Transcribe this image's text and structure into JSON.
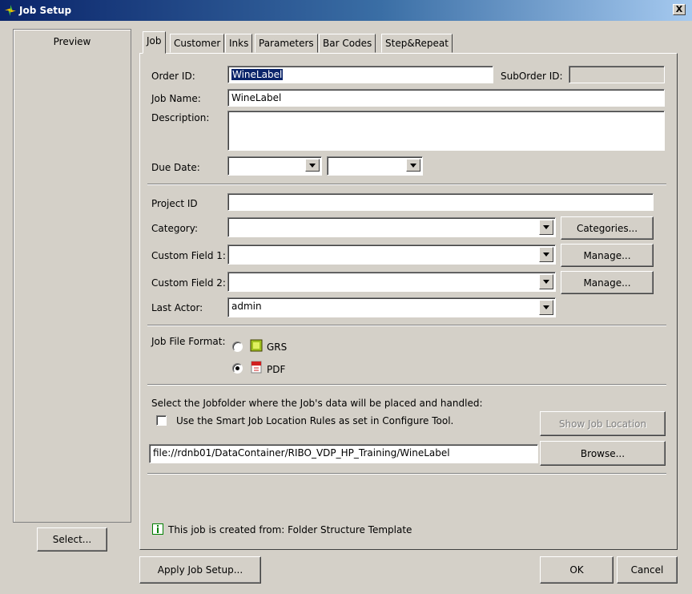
{
  "window": {
    "title": "Job Setup",
    "close_label": "X"
  },
  "preview": {
    "label": "Preview",
    "select_button": "Select..."
  },
  "tabs": [
    {
      "label": "Job"
    },
    {
      "label": "Customer"
    },
    {
      "label": "Inks"
    },
    {
      "label": "Parameters"
    },
    {
      "label": "Bar Codes"
    },
    {
      "label": "Step&Repeat"
    }
  ],
  "job": {
    "order_id_label": "Order ID:",
    "order_id_value": "WineLabel",
    "suborder_id_label": "SubOrder ID:",
    "suborder_id_value": "",
    "job_name_label": "Job Name:",
    "job_name_value": "WineLabel",
    "description_label": "Description:",
    "description_value": "",
    "due_date_label": "Due Date:",
    "due_date_value": "",
    "due_time_value": "",
    "project_id_label": "Project ID",
    "project_id_value": "",
    "category_label": "Category:",
    "category_value": "",
    "categories_button": "Categories...",
    "custom1_label": "Custom Field 1:",
    "custom1_value": "",
    "custom1_button": "Manage...",
    "custom2_label": "Custom Field 2:",
    "custom2_value": "",
    "custom2_button": "Manage...",
    "last_actor_label": "Last Actor:",
    "last_actor_value": "admin",
    "file_format_label": "Job File Format:",
    "format_grs": "GRS",
    "format_pdf": "PDF",
    "jobfolder_text": "Select the Jobfolder where the Job's data will be placed and handled:",
    "smart_rules_text": "Use the Smart Job Location Rules as set in Configure Tool.",
    "show_location_button": "Show Job Location",
    "path_value": "file://rdnb01/DataContainer/RIBO_VDP_HP_Training/WineLabel",
    "browse_button": "Browse...",
    "info_text": "This job is created from: Folder Structure Template"
  },
  "footer": {
    "apply": "Apply Job Setup...",
    "ok": "OK",
    "cancel": "Cancel"
  }
}
